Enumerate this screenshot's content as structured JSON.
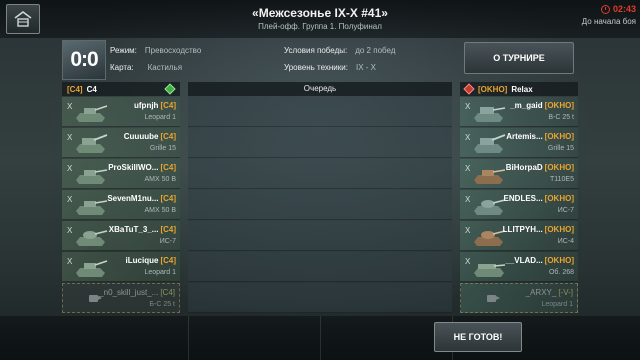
{
  "header": {
    "title": "«Межсезонье IX-X #41»",
    "subtitle": "Плей-офф. Группа 1. Полуфинал",
    "timer": "02:43",
    "timer_label": "До начала боя"
  },
  "info": {
    "score": "0:0",
    "mode_label": "Режим:",
    "mode_value": "Превосходство",
    "map_label": "Карта:",
    "map_value": "Кастилья",
    "victory_label": "Условия победы:",
    "victory_value": "до 2 побед",
    "tier_label": "Уровень техники:",
    "tier_value": "IX - X"
  },
  "tournament_button": "О ТУРНИРЕ",
  "ready_button": "НЕ ГОТОВ!",
  "queue_label": "Очередь",
  "left_team": {
    "tag": "[C4]",
    "name": "C4",
    "players": [
      {
        "x": "X",
        "name": "ufpnjh",
        "tag": "[C4]",
        "vehicle": "Leopard 1"
      },
      {
        "x": "X",
        "name": "Cuuuube",
        "tag": "[C4]",
        "vehicle": "Grille 15"
      },
      {
        "x": "X",
        "name": "ProSkillWO...",
        "tag": "[C4]",
        "vehicle": "AMX 50 B"
      },
      {
        "x": "X",
        "name": "SevenM1nu...",
        "tag": "[C4]",
        "vehicle": "AMX 50 B"
      },
      {
        "x": "X",
        "name": "XBaTuT_3_...",
        "tag": "[C4]",
        "vehicle": "ИС-7"
      },
      {
        "x": "X",
        "name": "iLucique",
        "tag": "[C4]",
        "vehicle": "Leopard 1"
      },
      {
        "x": "",
        "name": "_n0_skill_just_...",
        "tag": "[C4]",
        "vehicle": "Б-С 25 t"
      }
    ]
  },
  "right_team": {
    "tag": "[OKHO]",
    "name": "Relax",
    "players": [
      {
        "x": "X",
        "name": "_m_gaid",
        "tag": "[OKHO]",
        "vehicle": "В-С 25 t"
      },
      {
        "x": "X",
        "name": "Artemis...",
        "tag": "[OKHO]",
        "vehicle": "Grille 15"
      },
      {
        "x": "X",
        "name": "BiHorpaD",
        "tag": "[OKHO]",
        "vehicle": "T110E5"
      },
      {
        "x": "X",
        "name": "ENDLES...",
        "tag": "[OKHO]",
        "vehicle": "ИС-7"
      },
      {
        "x": "X",
        "name": "LLITPYH...",
        "tag": "[OKHO]",
        "vehicle": "ИС-4"
      },
      {
        "x": "X",
        "name": "__VLAD...",
        "tag": "[OKHO]",
        "vehicle": "Об. 268"
      },
      {
        "x": "",
        "name": "_ARXY_",
        "tag": "[-V-]",
        "vehicle": "Leopard 1"
      }
    ]
  },
  "colors": {
    "accent_orange": "#e8a530",
    "timer_red": "#e03a2c",
    "left_marker": "#3fae4a",
    "right_marker": "#c23a30"
  }
}
